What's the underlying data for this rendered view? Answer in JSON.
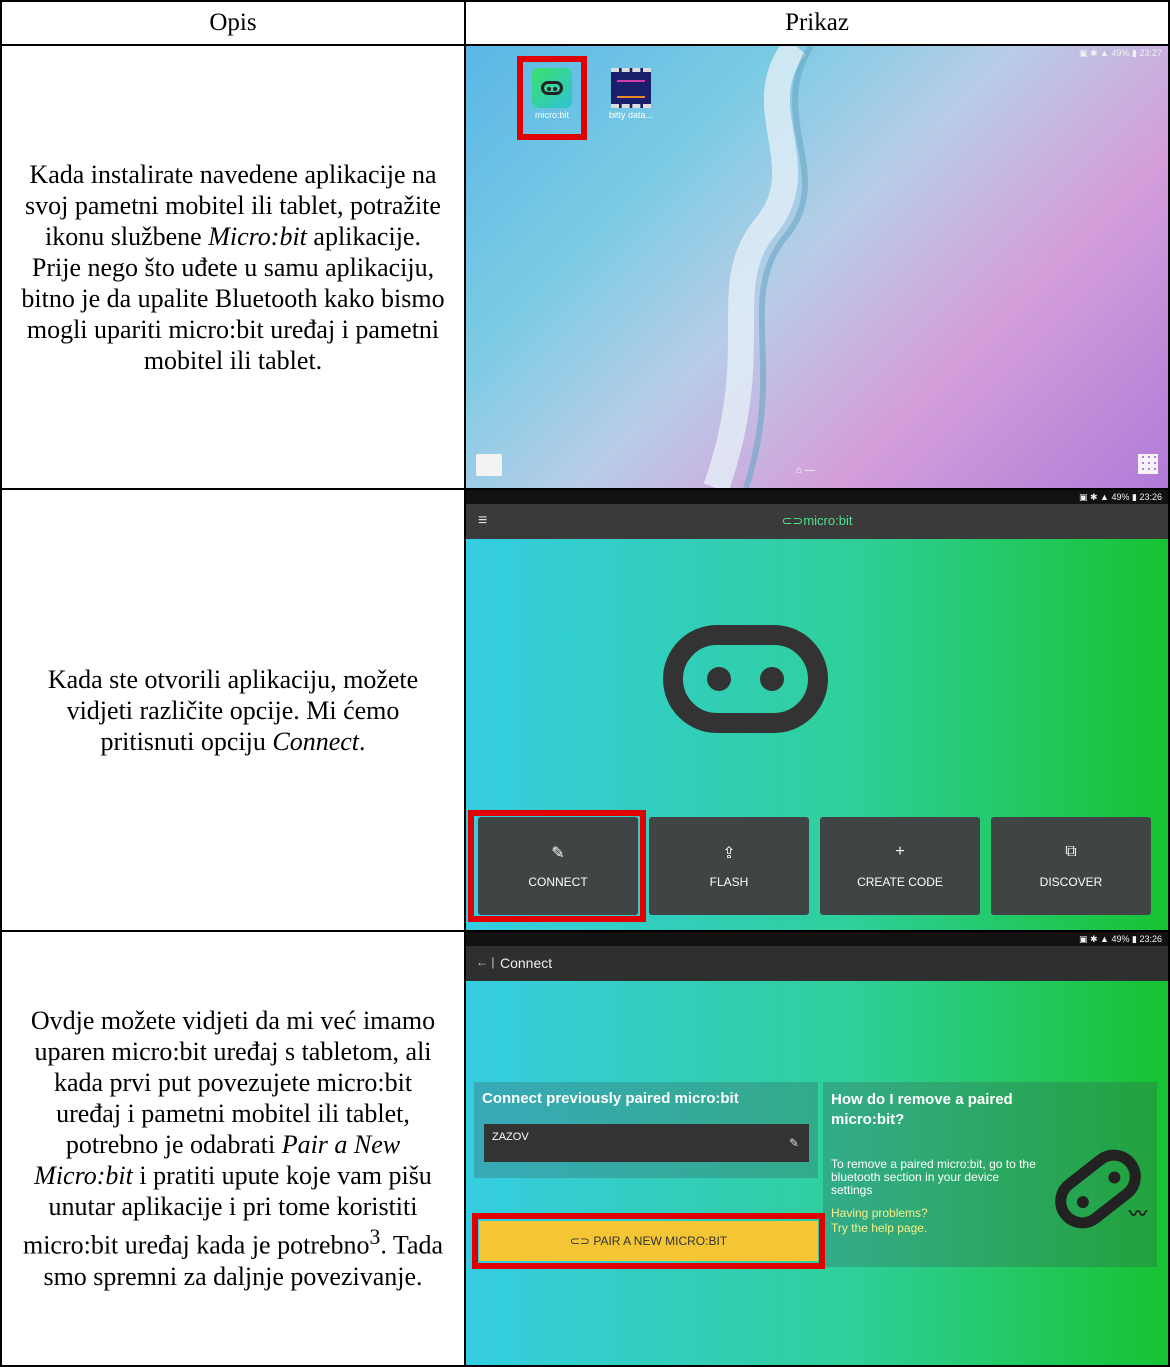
{
  "table": {
    "headers": {
      "left": "Opis",
      "right": "Prikaz"
    }
  },
  "rows": [
    {
      "text_html": "Kada instalirate navedene aplikacije na svoj pametni mobitel ili tablet, potražite ikonu službene <i>Micro:bit</i> aplikacije. Prije nego što uđete u samu aplikaciju, bitno je da upalite Bluetooth kako bismo mogli upariti micro:bit uređaj i pametni mobitel ili tablet.",
      "screen": {
        "status": "23:27",
        "battery": "49%",
        "apps": [
          {
            "label": "micro:bit",
            "icon": "microbit-app-icon"
          },
          {
            "label": "bitty data...",
            "icon": "bitty-data-app-icon"
          }
        ]
      }
    },
    {
      "text_html": "Kada ste otvorili aplikaciju, možete vidjeti različite opcije. Mi ćemo pritisnuti opciju <i>Connect</i>.",
      "screen": {
        "status": "23:26",
        "battery": "49%",
        "brand": "micro:bit",
        "tiles": [
          {
            "label": "CONNECT",
            "icon": "✎"
          },
          {
            "label": "FLASH",
            "icon": "⇪"
          },
          {
            "label": "CREATE CODE",
            "icon": "+"
          },
          {
            "label": "DISCOVER",
            "icon": "⧉"
          }
        ]
      }
    },
    {
      "text_html": "Ovdje možete vidjeti da mi već imamo uparen micro:bit uređaj s tabletom, ali kada prvi put povezujete micro:bit uređaj i pametni mobitel ili tablet, potrebno je odabrati <i>Pair a New Micro:bit</i> i pratiti upute koje vam pišu unutar aplikacije i pri tome koristiti micro:bit uređaj kada je potrebno<sup>3</sup>. Tada smo spremni za daljnje povezivanje.",
      "screen": {
        "status": "23:26",
        "battery": "49%",
        "title": "Connect",
        "paired_heading": "Connect previously paired micro:bit",
        "device": "ZAZOV",
        "pair_button": "PAIR A NEW MICRO:BIT",
        "help_heading": "How do I remove a paired micro:bit?",
        "help_body": "To remove a paired micro:bit, go to the bluetooth section in your device settings",
        "help_link_1": "Having problems?",
        "help_link_2": "Try the help page."
      }
    }
  ],
  "colors": {
    "highlight": "#e10000",
    "pair_button": "#f4c534",
    "brand_green": "#4de28f"
  }
}
